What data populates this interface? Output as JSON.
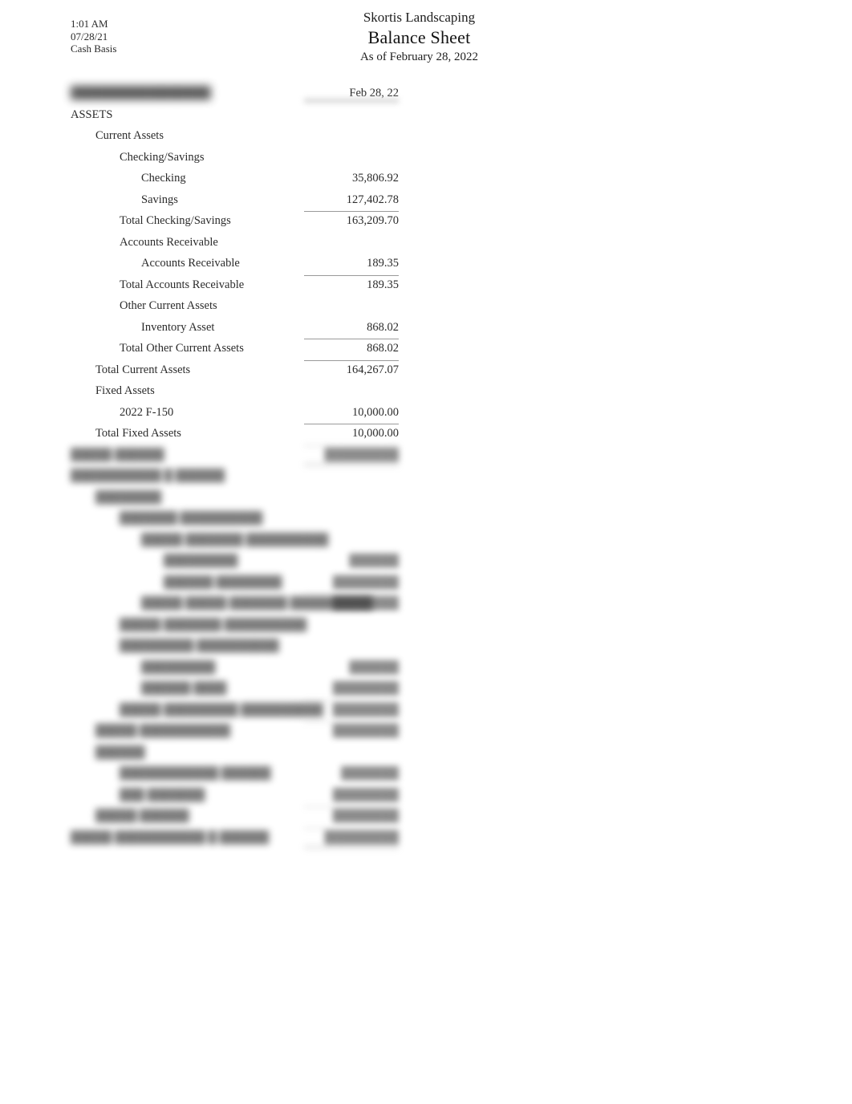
{
  "document": {
    "time": "1:01 AM",
    "date": "07/28/21",
    "basis": "Cash Basis",
    "company": "Skortis Landscaping",
    "title": "Balance Sheet",
    "subtitle": "As of February 28, 2022"
  },
  "table": {
    "column_header": "Feb 28, 22",
    "redacted_row_label": "█████████████████",
    "rows": [
      {
        "label": "ASSETS",
        "amount": "",
        "indent": 0,
        "redacted": false,
        "rule": "none"
      },
      {
        "label": "Current Assets",
        "amount": "",
        "indent": 1,
        "redacted": false,
        "rule": "none"
      },
      {
        "label": "Checking/Savings",
        "amount": "",
        "indent": 2,
        "redacted": false,
        "rule": "none"
      },
      {
        "label": "Checking",
        "amount": "35,806.92",
        "indent": 3,
        "redacted": false,
        "rule": "none"
      },
      {
        "label": "Savings",
        "amount": "127,402.78",
        "indent": 3,
        "redacted": false,
        "rule": "none"
      },
      {
        "label": "Total Checking/Savings",
        "amount": "163,209.70",
        "indent": 2,
        "redacted": false,
        "rule": "single"
      },
      {
        "label": "Accounts Receivable",
        "amount": "",
        "indent": 2,
        "redacted": false,
        "rule": "none"
      },
      {
        "label": "Accounts Receivable",
        "amount": "189.35",
        "indent": 3,
        "redacted": false,
        "rule": "none"
      },
      {
        "label": "Total Accounts Receivable",
        "amount": "189.35",
        "indent": 2,
        "redacted": false,
        "rule": "single"
      },
      {
        "label": "Other Current Assets",
        "amount": "",
        "indent": 2,
        "redacted": false,
        "rule": "none"
      },
      {
        "label": "Inventory Asset",
        "amount": "868.02",
        "indent": 3,
        "redacted": false,
        "rule": "none"
      },
      {
        "label": "Total Other Current Assets",
        "amount": "868.02",
        "indent": 2,
        "redacted": false,
        "rule": "single"
      },
      {
        "label": "Total Current Assets",
        "amount": "164,267.07",
        "indent": 1,
        "redacted": false,
        "rule": "single"
      },
      {
        "label": "Fixed Assets",
        "amount": "",
        "indent": 1,
        "redacted": false,
        "rule": "none"
      },
      {
        "label": "2022 F-150",
        "amount": "10,000.00",
        "indent": 2,
        "redacted": false,
        "rule": "none"
      },
      {
        "label": "Total Fixed Assets",
        "amount": "10,000.00",
        "indent": 1,
        "redacted": false,
        "rule": "single"
      },
      {
        "label": "█████ ██████",
        "amount": "█████████",
        "indent": 0,
        "redacted": true,
        "rule": "double"
      },
      {
        "label": "███████████ █ ██████",
        "amount": "",
        "indent": 0,
        "redacted": true,
        "rule": "none"
      },
      {
        "label": "████████",
        "amount": "",
        "indent": 1,
        "redacted": true,
        "rule": "none"
      },
      {
        "label": "███████ ██████████",
        "amount": "",
        "indent": 2,
        "redacted": true,
        "rule": "none"
      },
      {
        "label": "█████ ███████ ██████████",
        "amount": "",
        "indent": 3,
        "redacted": true,
        "rule": "none"
      },
      {
        "label": "█████████",
        "amount": "██████",
        "indent": 4,
        "redacted": true,
        "rule": "none"
      },
      {
        "label": "██████ ████████",
        "amount": "████████",
        "indent": 4,
        "redacted": true,
        "rule": "none"
      },
      {
        "label": "█████ █████ ███████ ██████████",
        "amount": "████████",
        "indent": 3,
        "redacted": true,
        "rule": "single"
      },
      {
        "label": "█████ ███████ ██████████",
        "amount": "",
        "indent": 2,
        "redacted": true,
        "rule": "none"
      },
      {
        "label": "█████████ ██████████",
        "amount": "",
        "indent": 2,
        "redacted": true,
        "rule": "none"
      },
      {
        "label": "█████████",
        "amount": "██████",
        "indent": 3,
        "redacted": true,
        "rule": "none"
      },
      {
        "label": "██████ ████",
        "amount": "████████",
        "indent": 3,
        "redacted": true,
        "rule": "none"
      },
      {
        "label": "█████ █████████ ██████████",
        "amount": "████████",
        "indent": 2,
        "redacted": true,
        "rule": "single"
      },
      {
        "label": "█████ ███████████",
        "amount": "████████",
        "indent": 1,
        "redacted": true,
        "rule": "single"
      },
      {
        "label": "██████",
        "amount": "",
        "indent": 1,
        "redacted": true,
        "rule": "none"
      },
      {
        "label": "████████████ ██████",
        "amount": "███████",
        "indent": 2,
        "redacted": true,
        "rule": "none"
      },
      {
        "label": "███ ███████",
        "amount": "████████",
        "indent": 2,
        "redacted": true,
        "rule": "none"
      },
      {
        "label": "█████ ██████",
        "amount": "████████",
        "indent": 1,
        "redacted": true,
        "rule": "single"
      },
      {
        "label": "█████ ███████████ █ ██████",
        "amount": "█████████",
        "indent": 0,
        "redacted": true,
        "rule": "double"
      }
    ]
  }
}
